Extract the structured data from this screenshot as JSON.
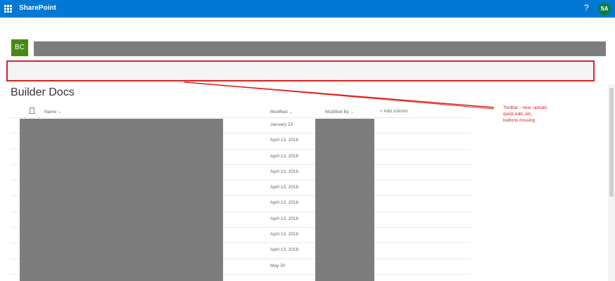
{
  "suite": {
    "app_name": "SharePoint",
    "help_label": "?",
    "user_initials": "SA"
  },
  "site": {
    "logo_initials": "BC"
  },
  "library": {
    "title": "Builder Docs"
  },
  "columns": {
    "type_icon": "doc-icon",
    "name": "Name",
    "modified": "Modified",
    "modified_by": "Modified By",
    "add_column": "+ Add column"
  },
  "rows": [
    {
      "modified": "January 23"
    },
    {
      "modified": "April 13, 2018"
    },
    {
      "modified": "April 13, 2018"
    },
    {
      "modified": "April 13, 2018"
    },
    {
      "modified": "April 13, 2018"
    },
    {
      "modified": "April 13, 2018"
    },
    {
      "modified": "April 13, 2018"
    },
    {
      "modified": "April 13, 2018"
    },
    {
      "modified": "April 13, 2018"
    },
    {
      "modified": "May 30"
    }
  ],
  "annotation": {
    "text_line1": "Toolbar - new, upload,",
    "text_line2": "quick edit, etc,",
    "text_line3": "buttons missing",
    "color": "#e02020"
  },
  "colors": {
    "suite_bar": "#0078d4",
    "avatar": "#107c41",
    "site_logo": "#4a8a12",
    "redaction": "#7d7d7d"
  }
}
